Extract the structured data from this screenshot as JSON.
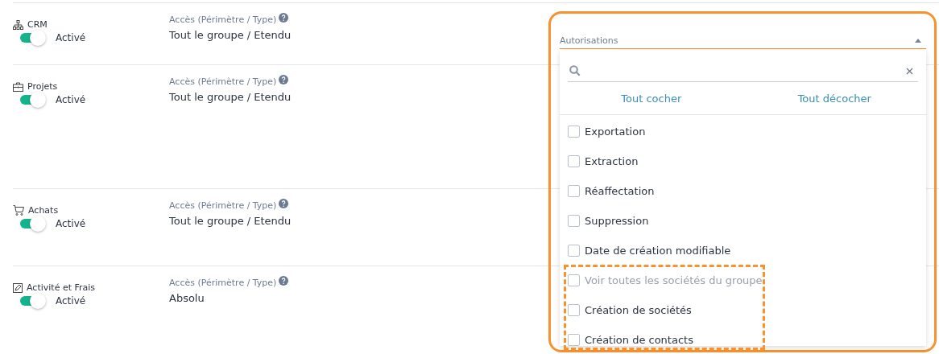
{
  "modules": [
    {
      "kind": "network",
      "name": "CRM",
      "toggle": {
        "on": true,
        "label": "Activé"
      },
      "access_label": "Accès (Périmètre / Type)",
      "access_value": "Tout le groupe / Etendu"
    },
    {
      "kind": "briefcase",
      "name": "Projets",
      "toggle": {
        "on": true,
        "label": "Activé"
      },
      "access_label": "Accès (Périmètre / Type)",
      "access_value": "Tout le groupe / Etendu"
    },
    {
      "kind": "cart",
      "name": "Achats",
      "toggle": {
        "on": true,
        "label": "Activé"
      },
      "access_label": "Accès (Périmètre / Type)",
      "access_value": "Tout le groupe / Etendu"
    },
    {
      "kind": "edit",
      "name": "Activité et Frais",
      "toggle": {
        "on": true,
        "label": "Activé"
      },
      "access_label": "Accès (Périmètre / Type)",
      "access_value": "Absolu"
    }
  ],
  "permissions_dropdown": {
    "label": "Autorisations",
    "expanded": true,
    "select_all": "Tout cocher",
    "deselect_all": "Tout décocher",
    "options": [
      {
        "label": "Exportation",
        "checked": false,
        "disabled": false
      },
      {
        "label": "Extraction",
        "checked": false,
        "disabled": false
      },
      {
        "label": "Réaffectation",
        "checked": false,
        "disabled": false
      },
      {
        "label": "Suppression",
        "checked": false,
        "disabled": false
      },
      {
        "label": "Date de création modifiable",
        "checked": false,
        "disabled": false
      },
      {
        "label": "Voir toutes les sociétés du groupe",
        "checked": false,
        "disabled": true
      },
      {
        "label": "Création de sociétés",
        "checked": false,
        "disabled": false
      },
      {
        "label": "Création de contacts",
        "checked": false,
        "disabled": false
      }
    ]
  }
}
